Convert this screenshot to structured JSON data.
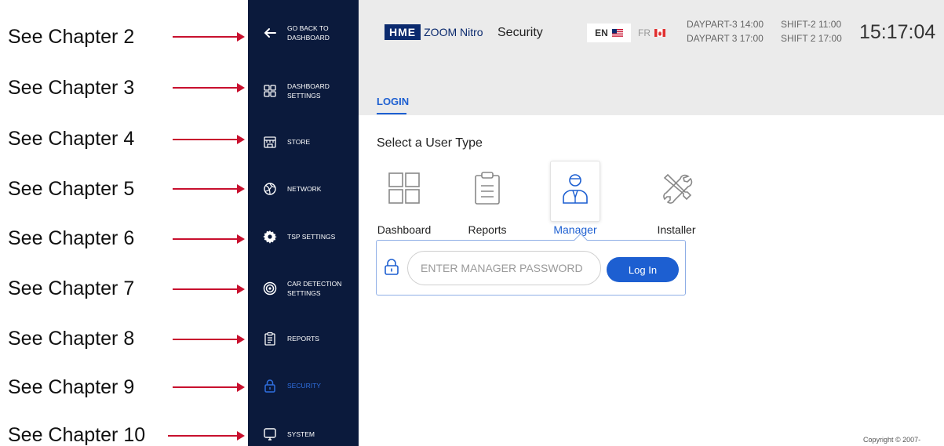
{
  "callouts": [
    {
      "label": "See Chapter 2"
    },
    {
      "label": "See Chapter 3"
    },
    {
      "label": "See Chapter 4"
    },
    {
      "label": "See Chapter 5"
    },
    {
      "label": "See Chapter 6"
    },
    {
      "label": "See Chapter 7"
    },
    {
      "label": "See Chapter 8"
    },
    {
      "label": "See Chapter 9"
    },
    {
      "label": "See Chapter 10"
    }
  ],
  "sidebar": {
    "items": [
      {
        "label": "GO BACK TO DASHBOARD",
        "icon": "arrow-left-icon"
      },
      {
        "label": "DASHBOARD SETTINGS",
        "icon": "grid-icon"
      },
      {
        "label": "STORE",
        "icon": "store-icon"
      },
      {
        "label": "NETWORK",
        "icon": "globe-icon"
      },
      {
        "label": "TSP SETTINGS",
        "icon": "gear-icon"
      },
      {
        "label": "CAR DETECTION SETTINGS",
        "icon": "radar-icon"
      },
      {
        "label": "REPORTS",
        "icon": "clipboard-icon"
      },
      {
        "label": "SECURITY",
        "icon": "lock-icon",
        "active": true
      },
      {
        "label": "SYSTEM",
        "icon": "monitor-icon"
      }
    ],
    "active_color": "#2f6fe0",
    "background": "#0b1a3c"
  },
  "header": {
    "logo": "HME",
    "product": "ZOOM Nitro",
    "page": "Security",
    "lang_en": "EN",
    "lang_fr": "FR",
    "schedule_1_row1": "DAYPART-3 14:00",
    "schedule_1_row2": "DAYPART 3 17:00",
    "schedule_2_row1": "SHIFT-2 11:00",
    "schedule_2_row2": "SHIFT 2 17:00",
    "clock": "15:17:04"
  },
  "tabs": {
    "login": "LOGIN"
  },
  "main": {
    "section_title": "Select a User Type",
    "user_types": [
      {
        "label": "Dashboard",
        "icon": "dashboard-grid-icon"
      },
      {
        "label": "Reports",
        "icon": "clipboard-icon"
      },
      {
        "label": "Manager",
        "icon": "manager-person-icon",
        "selected": true
      },
      {
        "label": "Installer",
        "icon": "tools-icon"
      }
    ],
    "password_placeholder": "ENTER MANAGER PASSWORD",
    "login_button": "Log In"
  },
  "footer": {
    "copyright": "Copyright © 2007-"
  },
  "colors": {
    "accent": "#1d5fd1",
    "callout_line": "#c8102e",
    "header_bg": "#ebebeb"
  }
}
